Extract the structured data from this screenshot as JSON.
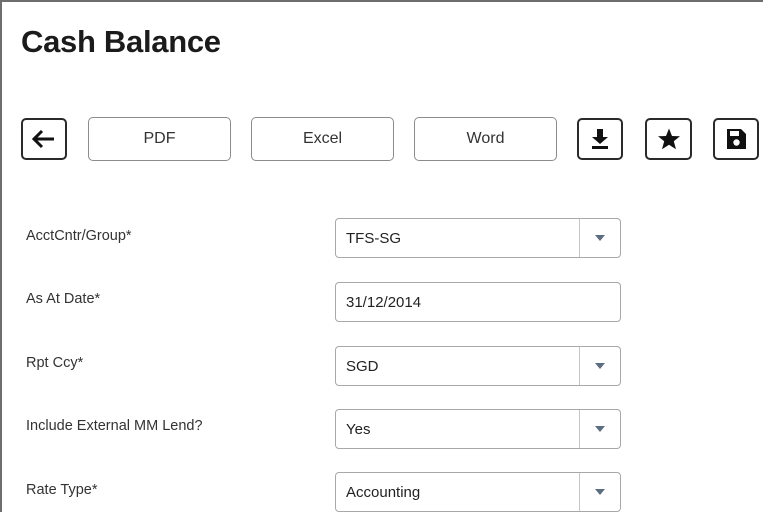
{
  "page": {
    "title": "Cash Balance"
  },
  "toolbar": {
    "pdf_label": "PDF",
    "excel_label": "Excel",
    "word_label": "Word"
  },
  "form": {
    "acct_label": "AcctCntr/Group*",
    "acct_value": "TFS-SG",
    "date_label": "As At Date*",
    "date_value": "31/12/2014",
    "ccy_label": "Rpt Ccy*",
    "ccy_value": "SGD",
    "mm_label": "Include External MM Lend?",
    "mm_value": "Yes",
    "rate_label": "Rate Type*",
    "rate_value": "Accounting"
  }
}
